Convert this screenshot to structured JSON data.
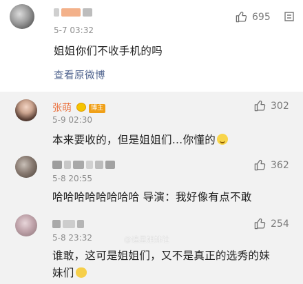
{
  "main_comment": {
    "timestamp": "5-7 03:32",
    "text": "姐姐你们不收手机的吗",
    "likes": "695",
    "view_weibo_link": "查看原微博"
  },
  "replies": [
    {
      "username": "张萌",
      "badge": "博主",
      "timestamp": "5-9 02:30",
      "text": "本来要收的，但是姐姐们…你懂的",
      "likes": "302"
    },
    {
      "timestamp": "5-8 20:55",
      "text": "哈哈哈哈哈哈哈哈 导演：我好像有点不敢",
      "likes": "362"
    },
    {
      "timestamp": "5-8 23:32",
      "text_line1": "谁敢，这可是姐姐们，又不是真正的选秀的妹",
      "text_line2": "妹们",
      "likes": "254"
    }
  ],
  "watermark": "@追星姐妹社",
  "icons": {
    "like": "thumbs-up-icon",
    "crown": "crown-icon",
    "emoji": "laughing-emoji-icon",
    "cat_emoji": "cat-emoji-icon"
  },
  "colors": {
    "username": "#eb7340",
    "link": "#50648f",
    "reply_bg": "#f2f2f2"
  }
}
